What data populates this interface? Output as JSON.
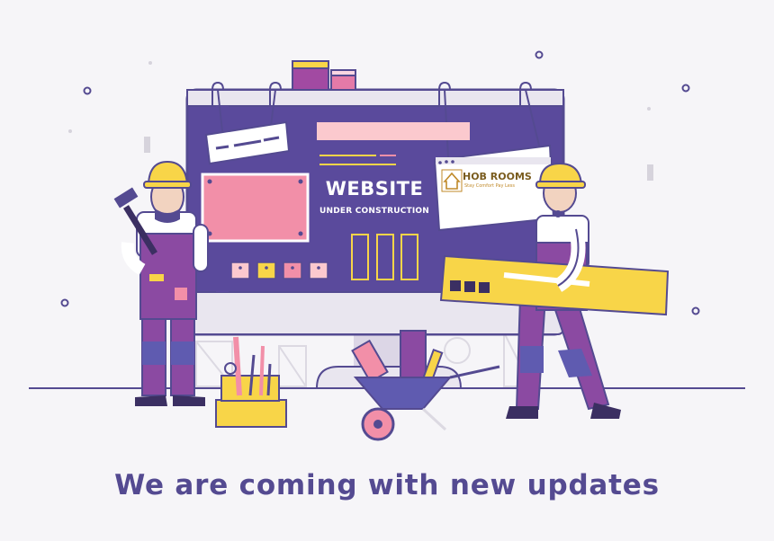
{
  "screen": {
    "title": "WEBSITE",
    "subtitle": "UNDER CONSTRUCTION"
  },
  "logo": {
    "name": "HOB ROOMS",
    "tagline": "Stay Comfort Pay Less"
  },
  "headline": "We are coming with new updates",
  "colors": {
    "background": "#f6f5f8",
    "screen": "#5a4a9c",
    "monitor_frame": "#e9e6ef",
    "accent_pink": "#f28fa8",
    "accent_yellow": "#f8d548",
    "overalls": "#8b4aa2",
    "headline": "#544a91"
  },
  "icons": [
    "hard-hat-icon",
    "hammer-icon",
    "toolbox-icon",
    "wheelbarrow-icon",
    "paint-can-icon"
  ]
}
